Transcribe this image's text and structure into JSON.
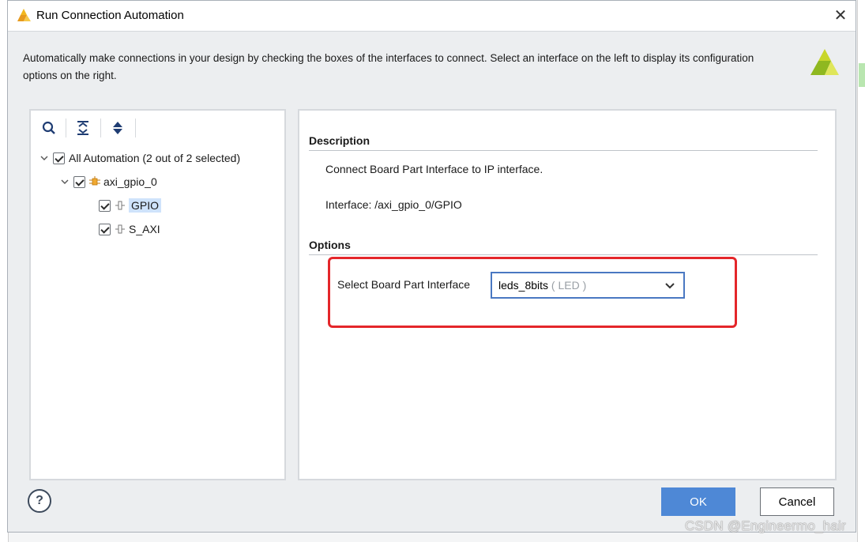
{
  "window": {
    "title": "Run Connection Automation",
    "close_symbol": "✕",
    "app_icon": "vivado-logo-icon"
  },
  "intro": {
    "text": "Automatically make connections in your design by checking the boxes of the interfaces to connect. Select an interface on the left to display its configuration options on the right."
  },
  "toolbar": {
    "icons": [
      "search-icon",
      "collapse-all-icon",
      "expand-all-icon"
    ]
  },
  "tree": {
    "root": {
      "label": "All Automation (2 out of 2 selected)",
      "checked": true,
      "expanded": true
    },
    "ip": {
      "label": "axi_gpio_0",
      "checked": true,
      "expanded": true,
      "icon": "ip-block-icon"
    },
    "interfaces": [
      {
        "label": "GPIO",
        "checked": true,
        "selected": true,
        "icon": "interface-port-icon"
      },
      {
        "label": "S_AXI",
        "checked": true,
        "selected": false,
        "icon": "interface-port-icon"
      }
    ]
  },
  "details": {
    "description_heading": "Description",
    "description_text": "Connect Board Part Interface to IP interface.",
    "interface_text": "Interface: /axi_gpio_0/GPIO",
    "options_heading": "Options",
    "select_label": "Select Board Part Interface",
    "select_value": "leds_8bits",
    "select_value_sub": " ( LED )"
  },
  "footer": {
    "help_label": "?",
    "ok_label": "OK",
    "cancel_label": "Cancel"
  },
  "watermark": "CSDN @Engineermo_hair",
  "colors": {
    "accent": "#4e88d6",
    "highlight": "#e4262a",
    "selection": "#cfe3fb"
  }
}
